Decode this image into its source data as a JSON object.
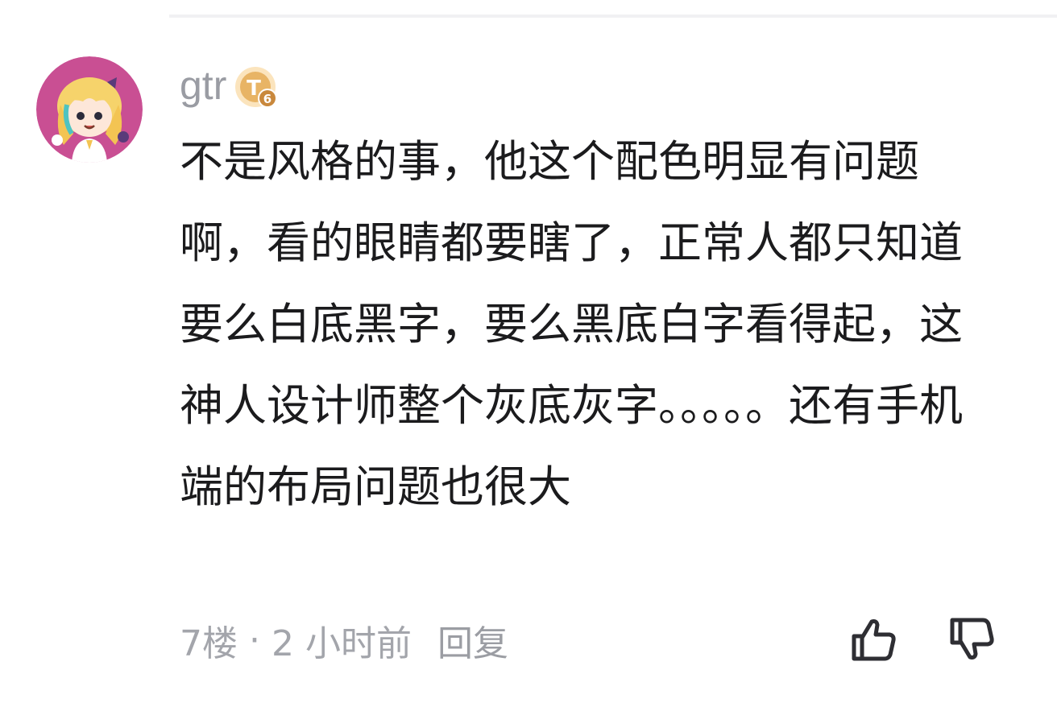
{
  "comment": {
    "username": "gtr",
    "level_badge": "6",
    "level_badge_icon": "level-badge-icon",
    "badge_color": "#d9a254",
    "avatar_bg": "#c94f93",
    "text": "不是风格的事，他这个配色明显有问题啊，看的眼睛都要瞎了，正常人都只知道要么白底黑字，要么黑底白字看得起，这神人设计师整个灰底灰字。。。。。还有手机端的布局问题也很大",
    "floor": "7楼",
    "separator": "·",
    "time": "2 小时前",
    "reply_label": "回复",
    "like_icon": "thumbs-up-icon",
    "dislike_icon": "thumbs-down-icon"
  }
}
